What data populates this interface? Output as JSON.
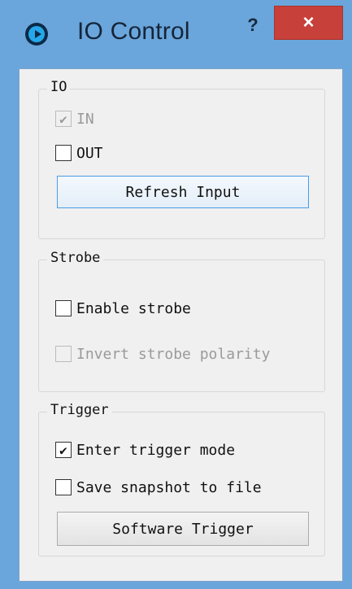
{
  "window": {
    "title": "IO Control",
    "help_label": "?",
    "close_label": "×"
  },
  "io_group": {
    "label": "IO",
    "in_label": "IN",
    "in_checked": true,
    "in_enabled": false,
    "out_label": "OUT",
    "out_checked": false,
    "refresh_button": "Refresh Input"
  },
  "strobe_group": {
    "label": "Strobe",
    "enable_label": "Enable strobe",
    "enable_checked": false,
    "invert_label": "Invert strobe polarity",
    "invert_checked": false,
    "invert_enabled": false
  },
  "trigger_group": {
    "label": "Trigger",
    "trigger_mode_label": "Enter trigger mode",
    "trigger_mode_checked": true,
    "save_snapshot_label": "Save snapshot to file",
    "save_snapshot_checked": false,
    "software_trigger_button": "Software Trigger"
  },
  "colors": {
    "title_bar": "#6aa6db",
    "close_button": "#c7403a",
    "focus_border": "#4a9be6"
  }
}
